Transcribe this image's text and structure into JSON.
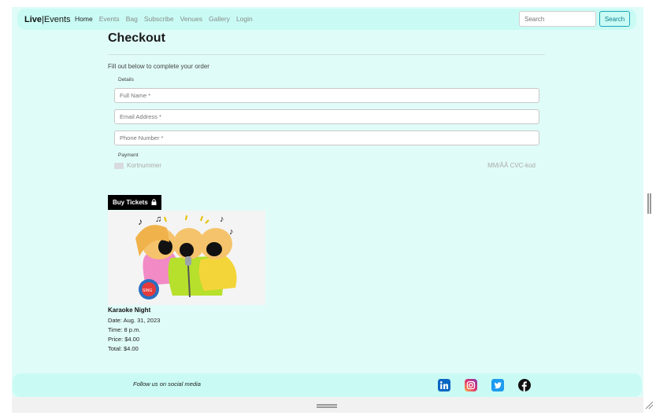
{
  "navbar": {
    "brand_bold": "Live",
    "brand_rest": "Events",
    "links": [
      "Home",
      "Events",
      "Bag",
      "Subscribe",
      "Venues",
      "Gallery",
      "Login"
    ],
    "search_placeholder": "Search",
    "search_button": "Search"
  },
  "checkout": {
    "title": "Checkout",
    "intro": "Fill out below to complete your order",
    "details_label": "Details",
    "full_name_placeholder": "Full Name *",
    "email_placeholder": "Email Address *",
    "phone_placeholder": "Phone Number *",
    "payment_label": "Payment",
    "card_number_placeholder": "Kortnummer",
    "card_extra_placeholder": "MM/ÅÅ CVC-kod",
    "buy_button": "Buy Tickets"
  },
  "event": {
    "title": "Karaoke Night",
    "date": "Date: Aug. 31, 2023",
    "time": "Time: 8 p.m.",
    "price": "Price: $4.00",
    "total": "Total: $4.00"
  },
  "footer": {
    "follow_text": "Follow us on social media",
    "social_icons": [
      "linkedin-icon",
      "instagram-icon",
      "twitter-icon",
      "facebook-icon"
    ]
  },
  "colors": {
    "page_bg": "#e0fcf8",
    "navbar_bg": "#c9fbf4",
    "accent": "#1fa4b8",
    "linkedin": "#0a66c2",
    "twitter": "#1d9bf0"
  }
}
